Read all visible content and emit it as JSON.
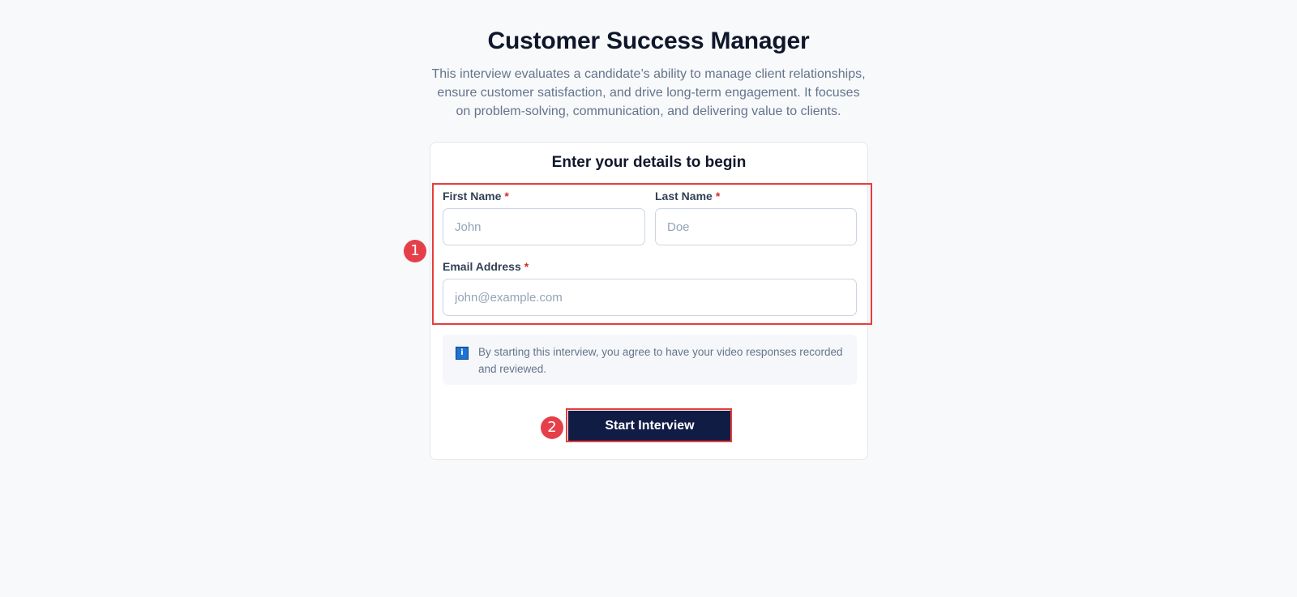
{
  "header": {
    "title": "Customer Success Manager",
    "description": "This interview evaluates a candidate’s ability to manage client relationships, ensure customer satisfaction, and drive long-term engagement. It focuses on problem-solving, communication, and delivering value to clients."
  },
  "form": {
    "title": "Enter your details to begin",
    "first_name": {
      "label": "First Name",
      "required_mark": "*",
      "value": "",
      "placeholder": "John"
    },
    "last_name": {
      "label": "Last Name",
      "required_mark": "*",
      "value": "",
      "placeholder": "Doe"
    },
    "email": {
      "label": "Email Address",
      "required_mark": "*",
      "value": "",
      "placeholder": "john@example.com"
    },
    "notice": {
      "icon": "info-icon",
      "icon_glyph": "i",
      "text": "By starting this interview, you agree to have your video responses recorded and reviewed."
    },
    "submit_label": "Start Interview"
  },
  "annotations": {
    "markers": [
      "1",
      "2"
    ],
    "highlight_color": "#e53e3e"
  },
  "colors": {
    "primary_button": "#111c45",
    "required": "#dc2626",
    "info": "#1e73d6"
  }
}
